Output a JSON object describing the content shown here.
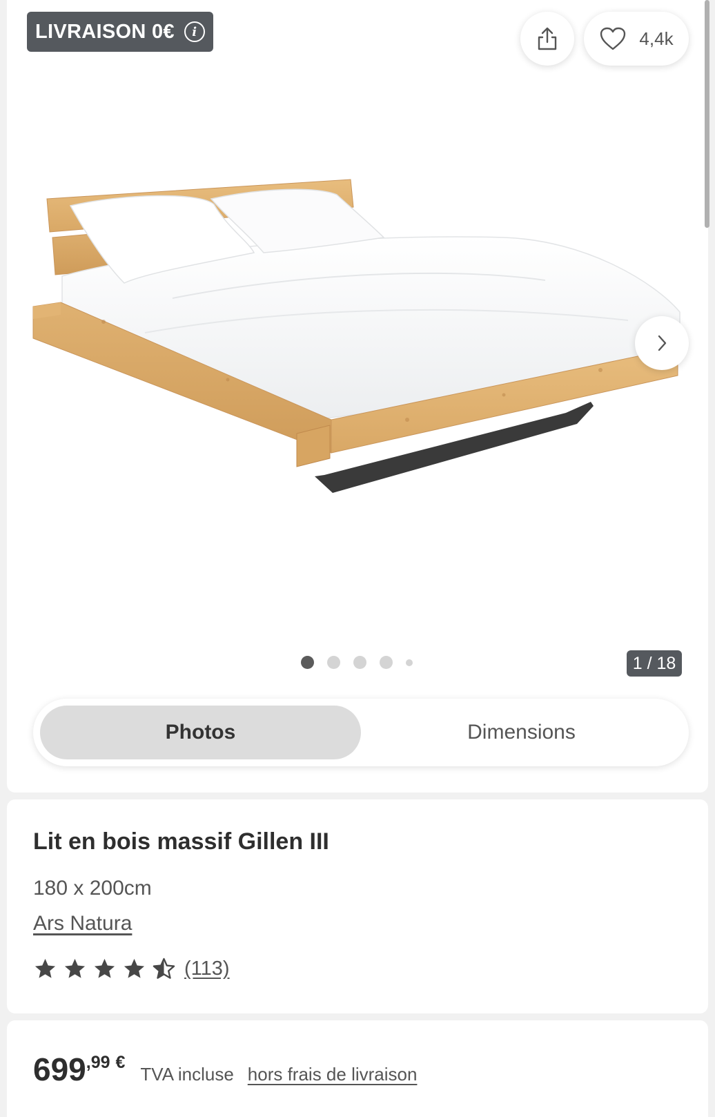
{
  "gallery": {
    "promo_badge": "LIVRAISON 0€",
    "favorites_count": "4,4k",
    "image_counter": "1 / 18",
    "dots": [
      true,
      false,
      false,
      false,
      false
    ],
    "view_tabs": [
      {
        "label": "Photos",
        "active": true
      },
      {
        "label": "Dimensions",
        "active": false
      }
    ],
    "image_alt": "Lit en bois massif Gillen III"
  },
  "product": {
    "title": "Lit en bois massif Gillen III",
    "dimensions": "180 x 200cm",
    "brand": "Ars Natura",
    "rating": 4.5,
    "rating_max": 5,
    "review_count": "(113)"
  },
  "price": {
    "main": "699",
    "cents": ",99",
    "currency": "€",
    "vat_note": "TVA incluse",
    "shipping_link": "hors frais de livraison"
  },
  "colors": {
    "badge_bg": "#55595e",
    "wood": "#dcae6e",
    "text": "#2e2e2e"
  }
}
